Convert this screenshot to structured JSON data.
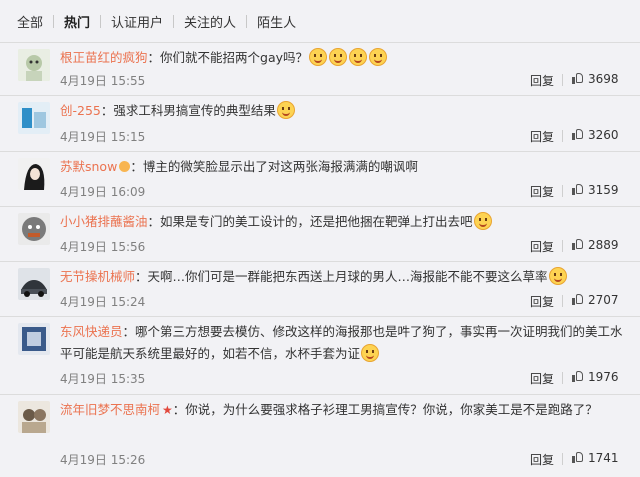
{
  "tabs": [
    "全部",
    "热门",
    "认证用户",
    "关注的人",
    "陌生人"
  ],
  "active_tab": "热门",
  "reply_label": "回复",
  "comments": [
    {
      "user": "根正苗红的疯狗",
      "text": "：你们就不能招两个gay吗？",
      "emoji": [
        "laugh-cry-emoji",
        "laugh-cry-emoji",
        "drool-emoji",
        "drool-emoji"
      ],
      "time": "4月19日 15:55",
      "likes": "3698"
    },
    {
      "user": "创-255",
      "text": "：强求工科男搞宣传的典型结果",
      "emoji": [
        "embarrassed-emoji"
      ],
      "time": "4月19日 15:15",
      "likes": "3260"
    },
    {
      "user": "苏默snow",
      "text": "：博主的微笑脸显示出了对这两张海报满满的嘲讽啊",
      "emoji": [],
      "time": "4月19日 16:09",
      "likes": "3159"
    },
    {
      "user": "小小猪排蘸酱油",
      "text": "：如果是专门的美工设计的，还是把他捆在靶弹上打出去吧",
      "emoji": [
        "smile-emoji"
      ],
      "time": "4月19日 15:56",
      "likes": "2889"
    },
    {
      "user": "无节操机械师",
      "text": "：天啊…你们可是一群能把东西送上月球的男人…海报能不能不要这么草率",
      "emoji": [
        "doge-emoji"
      ],
      "time": "4月19日 15:24",
      "likes": "2707"
    },
    {
      "user": "东风快递员",
      "text": "：哪个第三方想要去模仿、修改这样的海报那也是吽了狗了，事实再一次证明我们的美工水平可能是航天系统里最好的，如若不信，水杯手套为证",
      "emoji": [
        "doge-emoji"
      ],
      "time": "4月19日 15:35",
      "likes": "1976"
    },
    {
      "user": "流年旧梦不思南柯",
      "text": "：你说，为什么要强求格子衫理工男搞宣传？你说，你家美工是不是跑路了？",
      "emoji": [],
      "time": "4月19日 15:26",
      "likes": "1741"
    }
  ]
}
